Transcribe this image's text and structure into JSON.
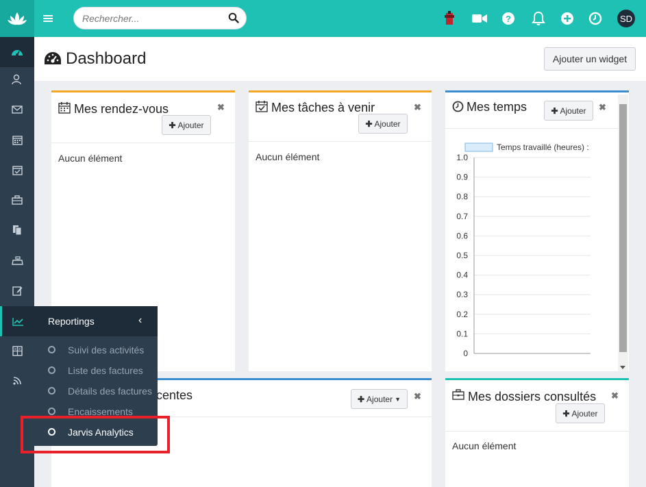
{
  "search": {
    "placeholder": "Rechercher..."
  },
  "header": {
    "title": "Dashboard",
    "add_widget_label": "Ajouter un widget"
  },
  "user": {
    "initials": "SD"
  },
  "widgets": {
    "rdv": {
      "title": "Mes rendez-vous",
      "add_label": "Ajouter",
      "empty": "Aucun élément"
    },
    "taches": {
      "title": "Mes tâches à venir",
      "add_label": "Ajouter",
      "empty": "Aucun élément"
    },
    "temps": {
      "title": "Mes temps",
      "add_label": "Ajouter"
    },
    "recentes": {
      "title_fragment": "centes",
      "add_label": "Ajouter"
    },
    "dossiers": {
      "title": "Mes dossiers consultés",
      "add_label": "Ajouter",
      "empty": "Aucun élément"
    }
  },
  "chart_data": {
    "type": "bar",
    "categories": [],
    "series": [
      {
        "name": "Temps travaillé (heures) :",
        "values": []
      }
    ],
    "yticks": [
      "1.0",
      "0.9",
      "0.8",
      "0.7",
      "0.6",
      "0.5",
      "0.4",
      "0.3",
      "0.2",
      "0.1",
      "0"
    ],
    "ylim": [
      0,
      1.0
    ],
    "grid": true,
    "legend": "top"
  },
  "flyout": {
    "title": "Reportings",
    "items": [
      {
        "label": "Suivi des activités"
      },
      {
        "label": "Liste des factures"
      },
      {
        "label": "Détails des factures"
      },
      {
        "label": "Encaissements"
      },
      {
        "label": "Jarvis Analytics"
      }
    ]
  },
  "colors": {
    "brand": "#1fc1b4",
    "sidebar": "#2d3e4f",
    "orange_accent": "#f5a623",
    "blue_accent": "#3a8ed0",
    "highlight": "#e8202a"
  }
}
